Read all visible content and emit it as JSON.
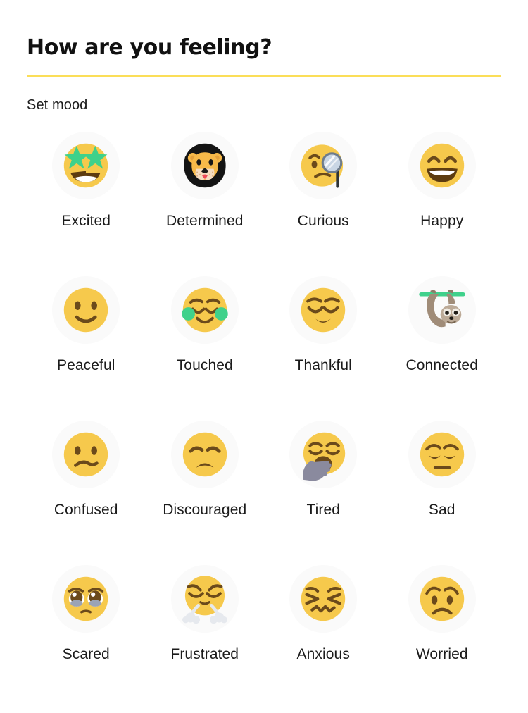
{
  "card": {
    "title": "How are you feeling?",
    "accent_color": "#FBDE58",
    "background_color": "#FFFFFF",
    "emoji_circle_color": "#FAFAFA"
  },
  "section": {
    "label": "Set mood"
  },
  "moods": [
    {
      "label": "Excited",
      "icon": "star-struck-face-icon"
    },
    {
      "label": "Determined",
      "icon": "lion-face-icon"
    },
    {
      "label": "Curious",
      "icon": "face-with-monocle-icon"
    },
    {
      "label": "Happy",
      "icon": "grinning-face-with-smiling-eyes-icon"
    },
    {
      "label": "Peaceful",
      "icon": "slightly-smiling-face-icon"
    },
    {
      "label": "Touched",
      "icon": "smiling-face-with-blush-icon"
    },
    {
      "label": "Thankful",
      "icon": "relieved-face-icon"
    },
    {
      "label": "Connected",
      "icon": "sloth-icon"
    },
    {
      "label": "Confused",
      "icon": "confused-face-icon"
    },
    {
      "label": "Discouraged",
      "icon": "disappointed-face-icon"
    },
    {
      "label": "Tired",
      "icon": "yawning-face-icon"
    },
    {
      "label": "Sad",
      "icon": "pensive-face-icon"
    },
    {
      "label": "Scared",
      "icon": "pleading-face-icon"
    },
    {
      "label": "Frustrated",
      "icon": "face-with-steam-from-nose-icon"
    },
    {
      "label": "Anxious",
      "icon": "confounded-face-icon"
    },
    {
      "label": "Worried",
      "icon": "worried-face-icon"
    }
  ],
  "palette": {
    "face_yellow": "#F6C94C",
    "face_yellow_dark": "#EFAE31",
    "feature_brown": "#6B4A1B",
    "star_green": "#3FD18B",
    "mane_black": "#141414",
    "lion_tan": "#F7B949",
    "sloth_brown": "#A08C78",
    "hand_gray": "#8A8A9E",
    "text_black": "#1B1B1B"
  }
}
